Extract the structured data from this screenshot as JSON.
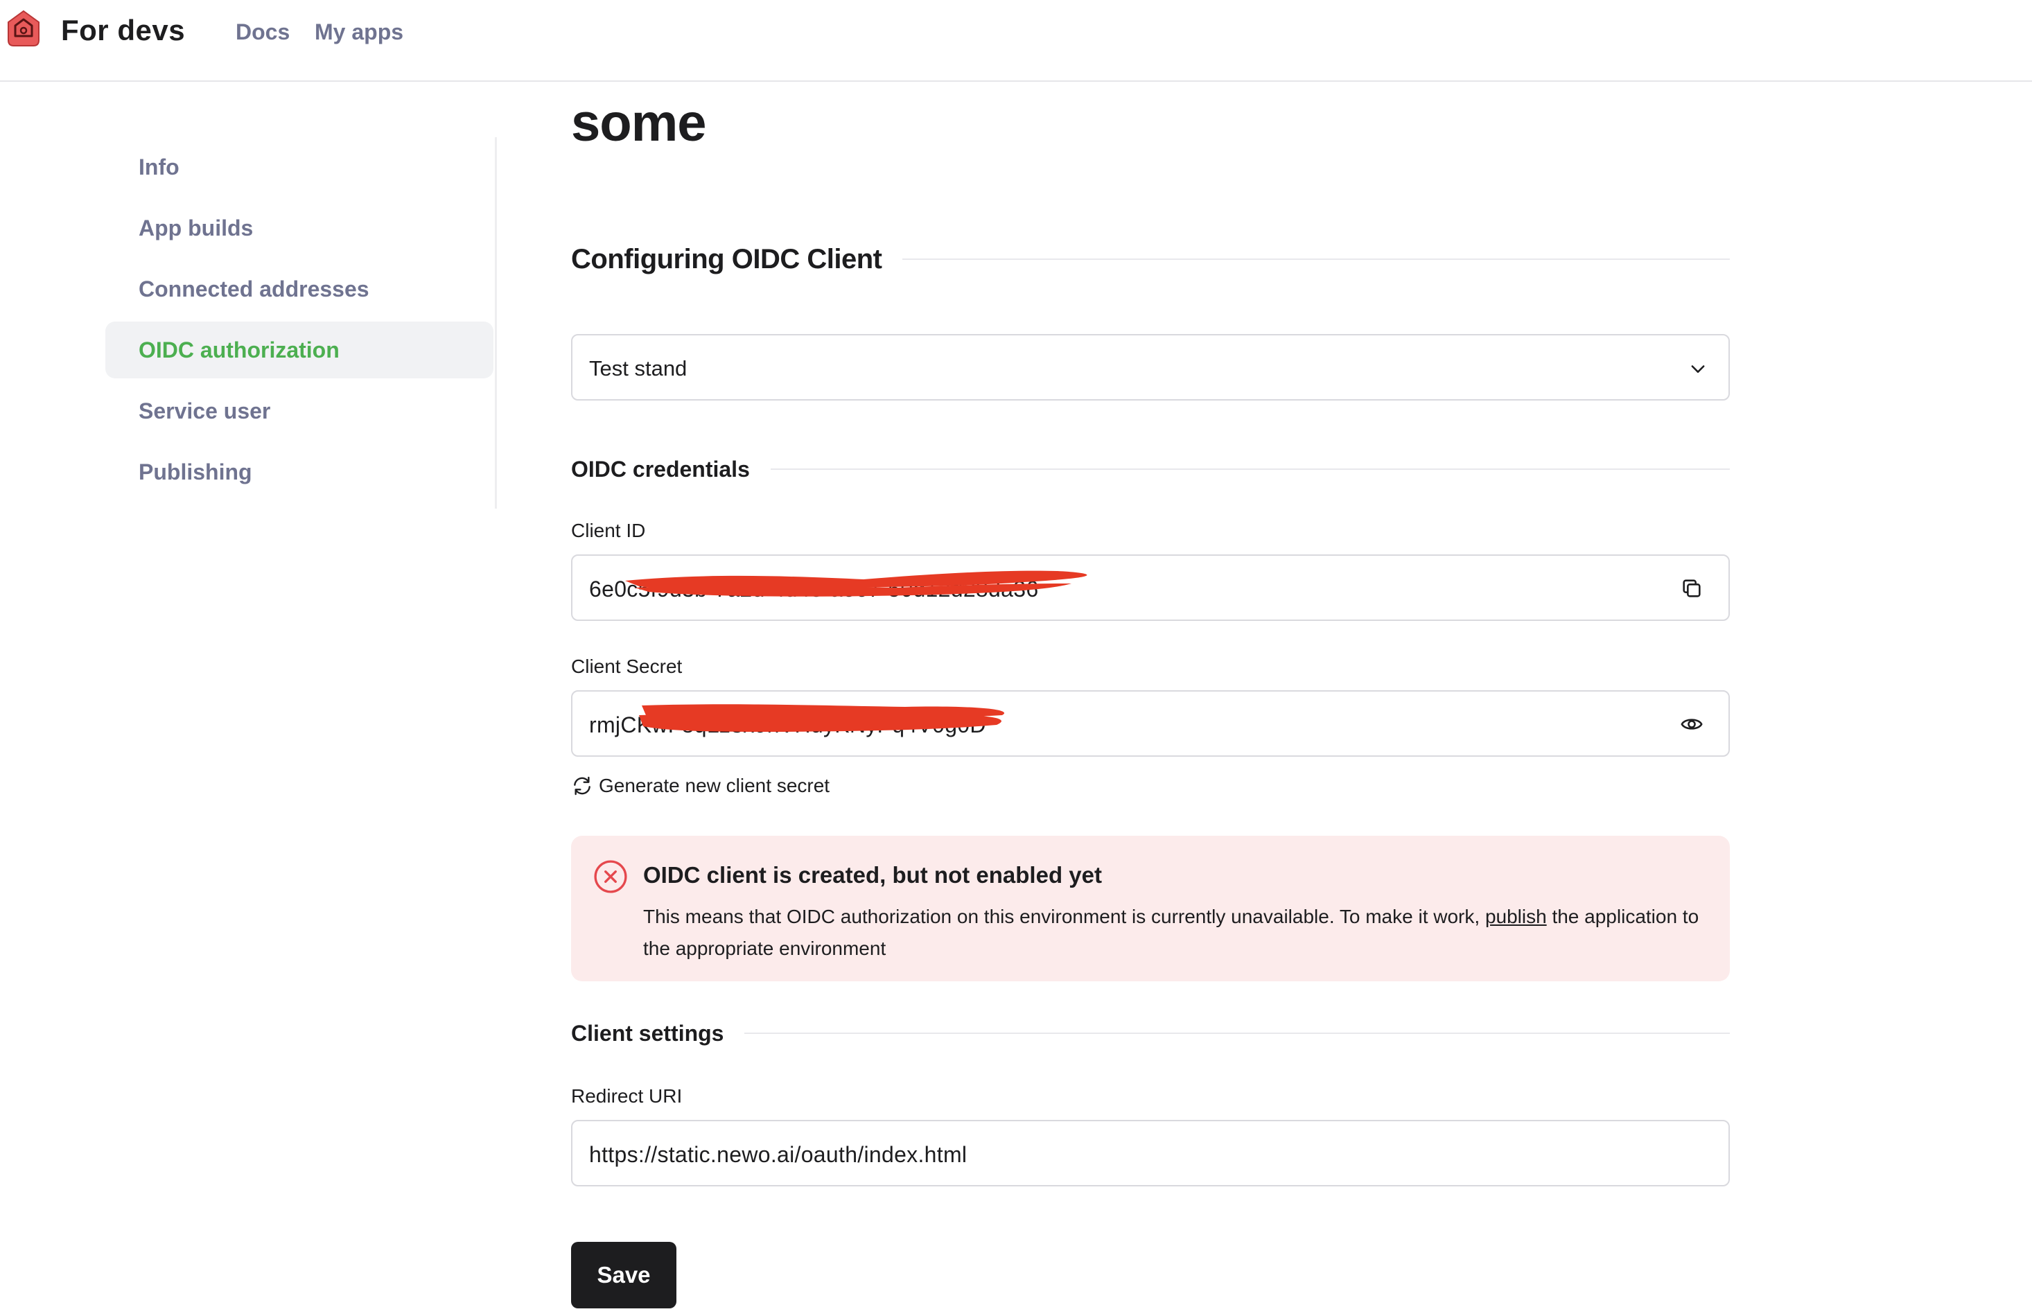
{
  "header": {
    "brand": "For devs",
    "nav": {
      "docs": "Docs",
      "my_apps": "My apps"
    },
    "logo_icon": "house-shield-logo-icon",
    "accent": "#e85a5a"
  },
  "sidebar": {
    "items": [
      {
        "label": "Info",
        "active": false
      },
      {
        "label": "App builds",
        "active": false
      },
      {
        "label": "Connected addresses",
        "active": false
      },
      {
        "label": "OIDC authorization",
        "active": true
      },
      {
        "label": "Service user",
        "active": false
      },
      {
        "label": "Publishing",
        "active": false
      }
    ],
    "active_color": "#4caf50"
  },
  "main": {
    "title": "some",
    "config_heading": "Configuring OIDC Client",
    "environment_select": {
      "value": "Test stand",
      "icon": "chevron-down-icon"
    },
    "credentials_heading": "OIDC credentials",
    "client_id": {
      "label": "Client ID",
      "value": "6e0c5f9d3b-7a2d-4d48-a867-50d12d28da36",
      "copy_icon": "copy-icon"
    },
    "client_secret": {
      "label": "Client Secret",
      "value": "rmjCKwF8qLz3x9nVHdyKNyPq4V0g0D",
      "reveal_icon": "eye-icon"
    },
    "regenerate_label": "Generate new client secret",
    "alert": {
      "title": "OIDC client is created, but not enabled yet",
      "body_before": "This means that OIDC authorization on this environment is currently unavailable. To make it work, ",
      "link": "publish",
      "body_after": " the application to the appropriate environment",
      "icon": "error-circle-icon",
      "color": "#e5484d",
      "background": "#fcebeb"
    },
    "client_settings_heading": "Client settings",
    "redirect_uri": {
      "label": "Redirect URI",
      "value": "https://static.newo.ai/oauth/index.html"
    },
    "save_label": "Save"
  }
}
